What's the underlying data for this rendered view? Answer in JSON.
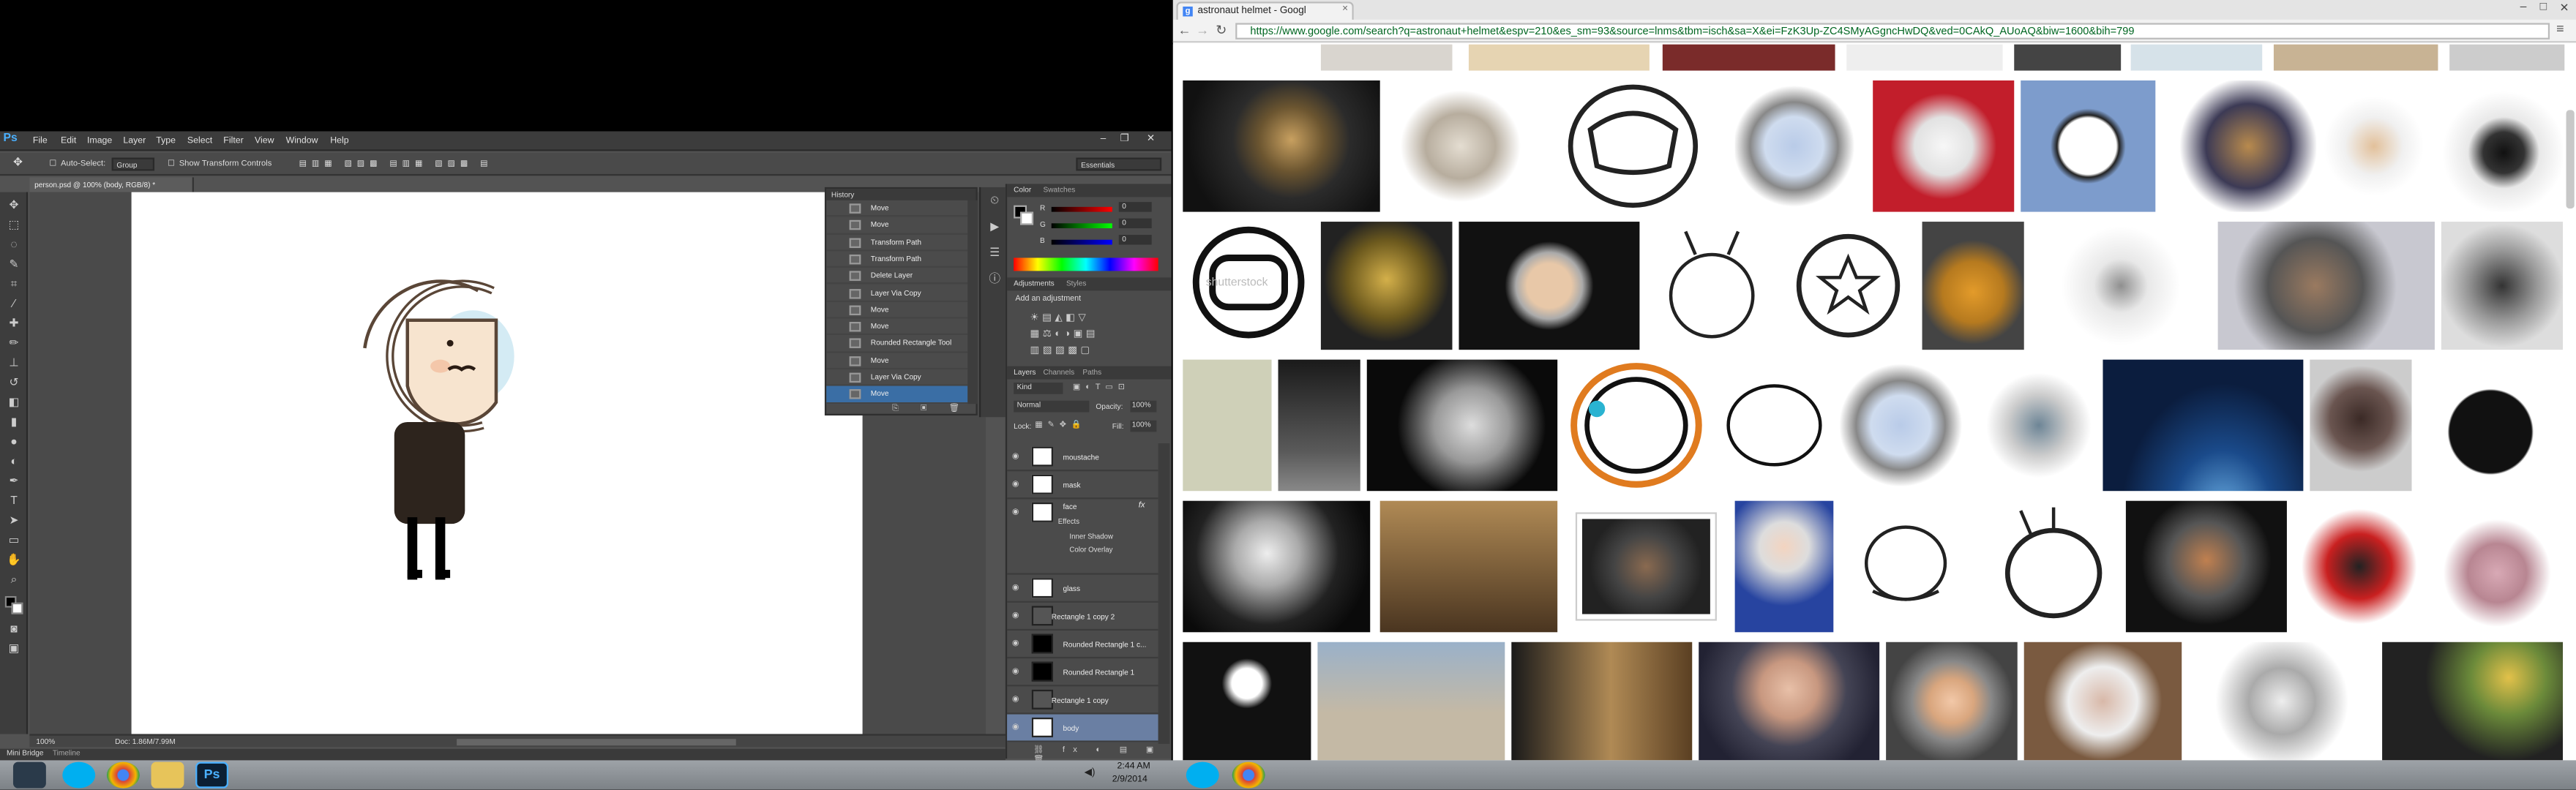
{
  "photoshop": {
    "menu": [
      "File",
      "Edit",
      "Image",
      "Layer",
      "Type",
      "Select",
      "Filter",
      "View",
      "Window",
      "Help"
    ],
    "logo": "Ps",
    "options": {
      "auto_select": "Auto-Select:",
      "group": "Group",
      "show_transform": "Show Transform Controls",
      "workspace": "Essentials"
    },
    "doc_tab": "person.psd @ 100% (body, RGB/8) *",
    "zoom": "100%",
    "doc_size": "Doc: 1.86M/7.99M",
    "bottom_tabs": [
      "Mini Bridge",
      "Timeline"
    ],
    "history": {
      "title": "History",
      "items": [
        "Move",
        "Move",
        "Transform Path",
        "Transform Path",
        "Delete Layer",
        "Layer Via Copy",
        "Move",
        "Move",
        "Rounded Rectangle Tool",
        "Move",
        "Layer Via Copy",
        "Move"
      ]
    },
    "color_panel": {
      "tabs": [
        "Color",
        "Swatches"
      ],
      "r": "0",
      "g": "0",
      "b": "0"
    },
    "adjustments": {
      "tabs": [
        "Adjustments",
        "Styles"
      ],
      "label": "Add an adjustment"
    },
    "layers_panel": {
      "tabs": [
        "Layers",
        "Channels",
        "Paths"
      ],
      "kind": "Kind",
      "blend": "Normal",
      "opacity_label": "Opacity:",
      "opacity": "100%",
      "lock": "Lock:",
      "fill_label": "Fill:",
      "fill": "100%",
      "layers": [
        "moustache",
        "mask",
        "face",
        "glass",
        "Rectangle 1 copy 2",
        "Rounded Rectangle 1 c...",
        "Rounded Rectangle 1",
        "Rectangle 1 copy",
        "body"
      ],
      "effects": {
        "label": "Effects",
        "items": [
          "Inner Shadow",
          "Color Overlay"
        ]
      }
    }
  },
  "chrome": {
    "tab_title": "astronaut helmet - Googl",
    "url": "https://www.google.com/search?q=astronaut+helmet&espv=210&es_sm=93&source=lnms&tbm=isch&sa=X&ei=FzK3Up-ZC4SMyAGgncHwDQ&ved=0CAkQ_AUoAQ&biw=1600&bih=799",
    "watermark": "shutterstock"
  },
  "taskbar": {
    "time": "2:44 AM",
    "date": "2/9/2014"
  }
}
